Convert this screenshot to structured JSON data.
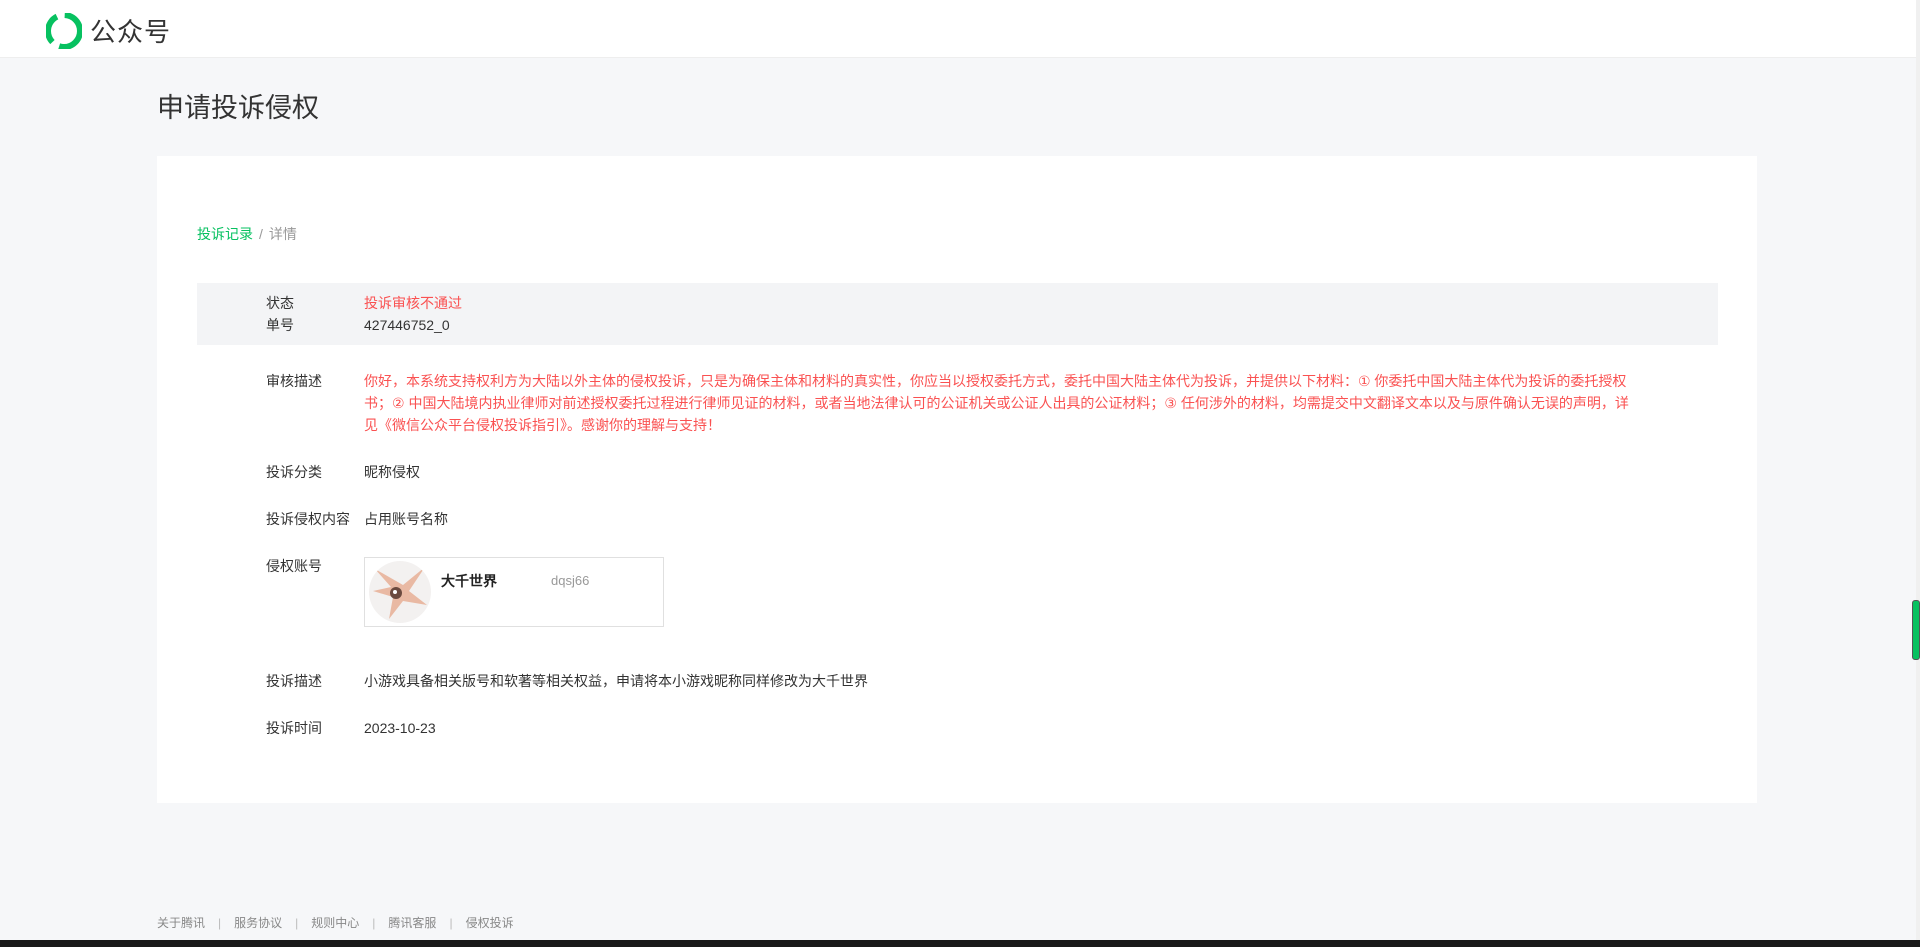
{
  "header": {
    "logo_text": "公众号"
  },
  "page": {
    "title": "申请投诉侵权"
  },
  "breadcrumb": {
    "link": "投诉记录",
    "separator": "/",
    "current": "详情"
  },
  "detail": {
    "status": {
      "label": "状态",
      "value": "投诉审核不通过"
    },
    "order": {
      "label": "单号",
      "value": "427446752_0"
    },
    "review": {
      "label": "审核描述",
      "value": "你好，本系统支持权利方为大陆以外主体的侵权投诉，只是为确保主体和材料的真实性，你应当以授权委托方式，委托中国大陆主体代为投诉，并提供以下材料：① 你委托中国大陆主体代为投诉的委托授权书；② 中国大陆境内执业律师对前述授权委托过程进行律师见证的材料，或者当地法律认可的公证机关或公证人出具的公证材料；③ 任何涉外的材料，均需提交中文翻译文本以及与原件确认无误的声明，详见《微信公众平台侵权投诉指引》。感谢你的理解与支持！"
    },
    "category": {
      "label": "投诉分类",
      "value": "昵称侵权"
    },
    "content": {
      "label": "投诉侵权内容",
      "value": "占用账号名称"
    },
    "account": {
      "label": "侵权账号",
      "name": "大千世界",
      "id": "dqsj66"
    },
    "description": {
      "label": "投诉描述",
      "value": "小游戏具备相关版号和软著等相关权益，申请将本小游戏昵称同样修改为大千世界"
    },
    "time": {
      "label": "投诉时间",
      "value": "2023-10-23"
    }
  },
  "footer": {
    "links": [
      "关于腾讯",
      "服务协议",
      "规则中心",
      "腾讯客服",
      "侵权投诉"
    ],
    "separator": "|"
  },
  "colors": {
    "accent": "#07c160",
    "error": "#fa5151"
  }
}
